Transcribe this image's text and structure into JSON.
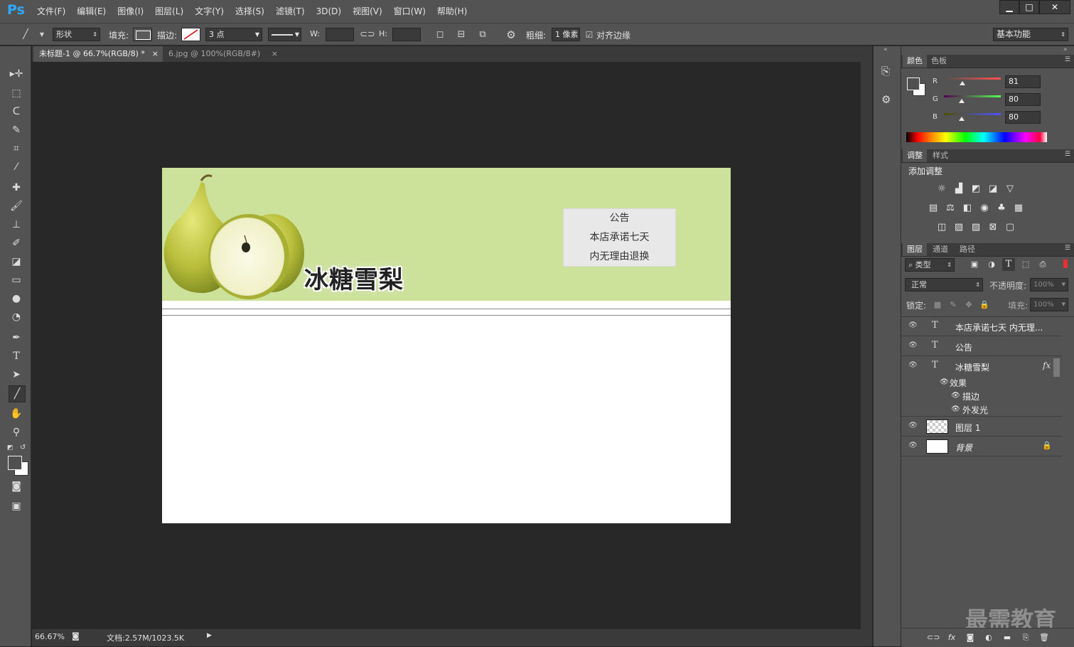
{
  "app": {
    "logo": "Ps"
  },
  "menu": [
    "文件(F)",
    "编辑(E)",
    "图像(I)",
    "图层(L)",
    "文字(Y)",
    "选择(S)",
    "滤镜(T)",
    "3D(D)",
    "视图(V)",
    "窗口(W)",
    "帮助(H)"
  ],
  "window_controls": {
    "minimize": "▁",
    "maximize": "□",
    "close": "✕"
  },
  "options": {
    "mode": "形状",
    "fill_label": "填充:",
    "stroke_label": "描边:",
    "stroke_width": "3 点",
    "w_label": "W:",
    "h_label": "H:",
    "weight_label": "粗细:",
    "weight_value": "1 像素",
    "align_edges": "对齐边缘",
    "workspace": "基本功能"
  },
  "doc_tabs": [
    {
      "label": "未标题-1 @ 66.7%(RGB/8) *",
      "close": "×"
    },
    {
      "label": "6.jpg @ 100%(RGB/8#)",
      "close": "×"
    }
  ],
  "document": {
    "banner_title": "冰糖雪梨",
    "notice": [
      "公告",
      "本店承诺七天",
      "内无理由退换"
    ],
    "banner_color": "#cce19a"
  },
  "status": {
    "zoom": "66.67%",
    "doc_info": "文档:2.57M/1023.5K"
  },
  "color_panel": {
    "tabs": [
      "颜色",
      "色板"
    ],
    "channels": [
      {
        "label": "R",
        "value": "81",
        "fraction": 0.32
      },
      {
        "label": "G",
        "value": "80",
        "fraction": 0.31
      },
      {
        "label": "B",
        "value": "80",
        "fraction": 0.31
      }
    ]
  },
  "adjust_panel": {
    "tabs": [
      "调整",
      "样式"
    ],
    "title": "添加调整"
  },
  "layers_panel": {
    "tabs": [
      "图层",
      "通道",
      "路径"
    ],
    "filter": "类型",
    "blend_mode": "正常",
    "opacity_label": "不透明度:",
    "opacity_value": "100%",
    "lock_label": "锁定:",
    "fill_label": "填充:",
    "fill_value": "100%",
    "layers": [
      {
        "name": "本店承诺七天 内无理...",
        "type": "T"
      },
      {
        "name": "公告",
        "type": "T"
      },
      {
        "name": "冰糖雪梨",
        "type": "T",
        "fx": "fx",
        "effects_label": "效果",
        "effects": [
          "描边",
          "外发光"
        ]
      },
      {
        "name": "图层 1",
        "type": "pixel"
      },
      {
        "name": "背景",
        "type": "background"
      }
    ]
  },
  "watermark": "最需教育"
}
